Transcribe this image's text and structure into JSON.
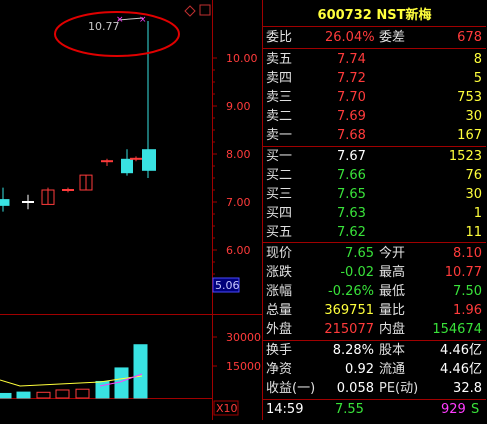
{
  "chart": {
    "price_ticks": [
      "10.00",
      "9.00",
      "8.00",
      "7.00",
      "6.00"
    ],
    "current_price_tag": "5.06",
    "annotation_high": "10.77",
    "volume_ticks": [
      "30000",
      "15000"
    ],
    "volume_mode": "X10",
    "colors": {
      "up": "#ff3b3b",
      "down": "#39e2e2",
      "ma": "#ffff3c"
    },
    "candles": [
      {
        "open": 6.93,
        "close": 7.05,
        "high": 7.3,
        "low": 6.8,
        "up": false,
        "partial": true
      },
      {
        "open": 7.0,
        "close": 7.0,
        "high": 7.15,
        "low": 6.85,
        "up": false
      },
      {
        "open": 6.95,
        "close": 7.25,
        "high": 7.3,
        "low": 6.95,
        "up": true
      },
      {
        "open": 7.25,
        "close": 7.25,
        "high": 7.3,
        "low": 7.2,
        "up": true,
        "flat": true
      },
      {
        "open": 7.25,
        "close": 7.56,
        "high": 7.56,
        "low": 7.25,
        "up": true
      },
      {
        "open": 7.85,
        "close": 7.85,
        "high": 7.9,
        "low": 7.75,
        "up": true,
        "flat": true
      },
      {
        "open": 7.9,
        "close": 7.6,
        "high": 8.1,
        "low": 7.55,
        "up": false
      },
      {
        "open": 7.9,
        "close": 7.9,
        "high": 7.95,
        "low": 7.85,
        "up": true,
        "flat": true
      },
      {
        "open": 8.1,
        "close": 7.65,
        "high": 10.77,
        "low": 7.5,
        "up": false
      }
    ],
    "volumes": [
      2200,
      800,
      1500,
      1400,
      2600,
      3000,
      7000,
      14000,
      26000
    ]
  },
  "header": {
    "code_name": "600732 NST新梅"
  },
  "ratio": {
    "label1": "委比",
    "value1": "26.04%",
    "label2": "委差",
    "value2": "678"
  },
  "asks": [
    {
      "label": "卖五",
      "price": "7.74",
      "vol": "8"
    },
    {
      "label": "卖四",
      "price": "7.72",
      "vol": "5"
    },
    {
      "label": "卖三",
      "price": "7.70",
      "vol": "753"
    },
    {
      "label": "卖二",
      "price": "7.69",
      "vol": "30"
    },
    {
      "label": "卖一",
      "price": "7.68",
      "vol": "167"
    }
  ],
  "bids": [
    {
      "label": "买一",
      "price": "7.67",
      "vol": "1523"
    },
    {
      "label": "买二",
      "price": "7.66",
      "vol": "76"
    },
    {
      "label": "买三",
      "price": "7.65",
      "vol": "30"
    },
    {
      "label": "买四",
      "price": "7.63",
      "vol": "1"
    },
    {
      "label": "买五",
      "price": "7.62",
      "vol": "11"
    }
  ],
  "stats": [
    {
      "l1": "现价",
      "v1": "7.65",
      "l2": "今开",
      "v2": "8.10"
    },
    {
      "l1": "涨跌",
      "v1": "-0.02",
      "l2": "最高",
      "v2": "10.77"
    },
    {
      "l1": "涨幅",
      "v1": "-0.26%",
      "l2": "最低",
      "v2": "7.50"
    },
    {
      "l1": "总量",
      "v1": "369751",
      "l2": "量比",
      "v2": "1.96"
    },
    {
      "l1": "外盘",
      "v1": "215077",
      "l2": "内盘",
      "v2": "154674"
    }
  ],
  "stats2": [
    {
      "l1": "换手",
      "v1": "8.28%",
      "l2": "股本",
      "v2": "4.46亿"
    },
    {
      "l1": "净资",
      "v1": "0.92",
      "l2": "流通",
      "v2": "4.46亿"
    },
    {
      "l1": "收益(一)",
      "v1": "0.058",
      "l2": "PE(动)",
      "v2": "32.8"
    }
  ],
  "footer": {
    "time": "14:59",
    "price": "7.55",
    "volume": "929",
    "flag": "S"
  }
}
